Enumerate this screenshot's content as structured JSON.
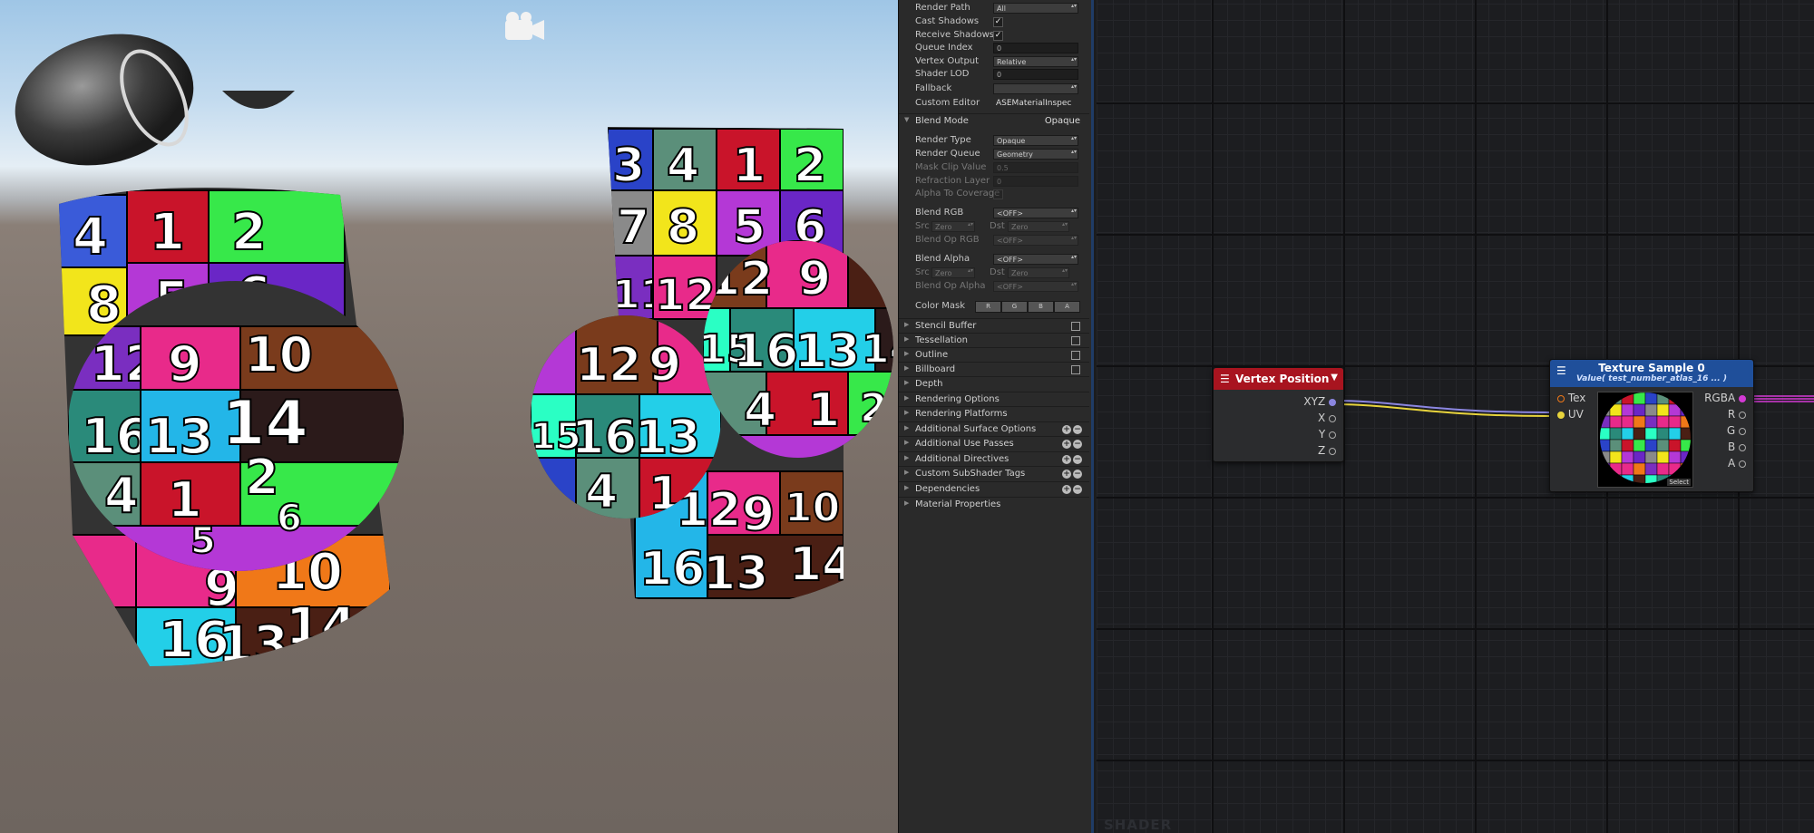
{
  "inspector": {
    "render_path": {
      "label": "Render Path",
      "value": "All"
    },
    "cast_shadows": {
      "label": "Cast Shadows",
      "check": "✓"
    },
    "receive_shadows": {
      "label": "Receive Shadows",
      "check": "✓"
    },
    "queue_index": {
      "label": "Queue Index",
      "value": "0"
    },
    "vertex_output": {
      "label": "Vertex Output",
      "value": "Relative"
    },
    "shader_lod": {
      "label": "Shader LOD",
      "value": "0"
    },
    "fallback": {
      "label": "Fallback",
      "value": ""
    },
    "custom_editor": {
      "label": "Custom Editor",
      "value": "ASEMaterialInspec"
    },
    "blend_mode": {
      "label": "Blend Mode",
      "value": "Opaque"
    },
    "render_type": {
      "label": "Render Type",
      "value": "Opaque"
    },
    "render_queue": {
      "label": "Render Queue",
      "value": "Geometry"
    },
    "mask_clip": {
      "label": "Mask Clip Value",
      "value": "0.5"
    },
    "refraction_layer": {
      "label": "Refraction Layer",
      "value": "0"
    },
    "alpha_coverage": {
      "label": "Alpha To Coverage"
    },
    "blend_rgb": {
      "label": "Blend RGB",
      "value": "<OFF>"
    },
    "blend_rgb_src": {
      "label": "Src",
      "value": "Zero",
      "dst_label": "Dst",
      "dst_value": "Zero"
    },
    "blend_op_rgb": {
      "label": "Blend Op RGB",
      "value": "<OFF>"
    },
    "blend_alpha": {
      "label": "Blend Alpha",
      "value": "<OFF>"
    },
    "blend_alpha_src": {
      "label": "Src",
      "value": "Zero",
      "dst_label": "Dst",
      "dst_value": "Zero"
    },
    "blend_op_alpha": {
      "label": "Blend Op Alpha",
      "value": "<OFF>"
    },
    "color_mask": {
      "label": "Color Mask",
      "channels": [
        "R",
        "G",
        "B",
        "A"
      ]
    },
    "sections": [
      "Stencil Buffer",
      "Tessellation",
      "Outline",
      "Billboard",
      "Depth",
      "Rendering Options",
      "Rendering Platforms",
      "Additional Surface Options",
      "Additional Use Passes",
      "Additional Directives",
      "Custom SubShader Tags",
      "Dependencies",
      "Material Properties"
    ]
  },
  "nodes": {
    "vertex_position": {
      "title": "Vertex Position",
      "color": "#a8141f",
      "outputs": [
        "XYZ",
        "X",
        "Y",
        "Z"
      ]
    },
    "texture_sample": {
      "title": "Texture Sample 0",
      "subtitle": "Value( test_number_atlas_16 ... )",
      "color": "#1f4f9a",
      "inputs": [
        "Tex",
        "UV"
      ],
      "outputs": [
        "RGBA",
        "R",
        "G",
        "B",
        "A"
      ],
      "select_label": "Select"
    }
  },
  "graph_watermark": "SHADER",
  "scene": {
    "camera_icon": "camera-gizmo-icon"
  }
}
